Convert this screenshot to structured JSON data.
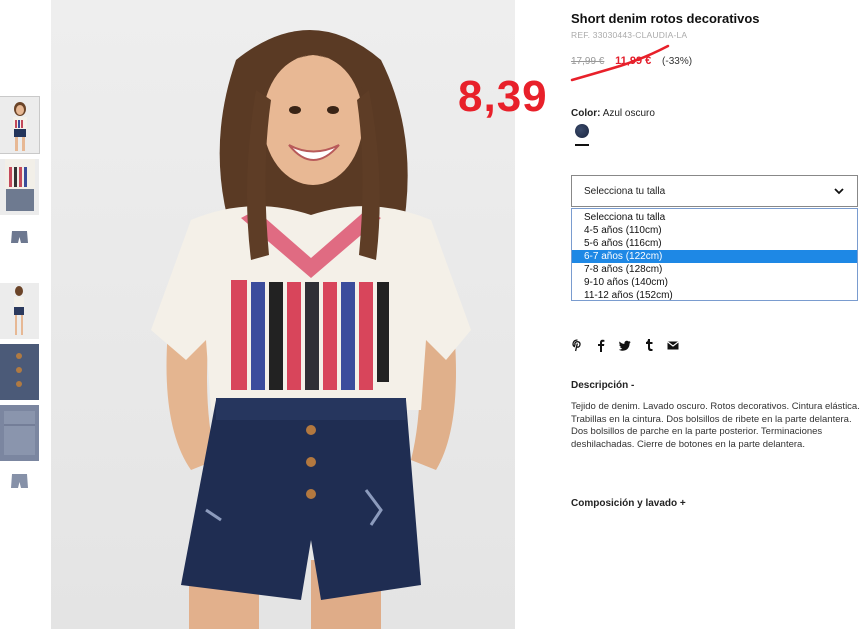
{
  "product": {
    "title": "Short denim rotos decorativos",
    "ref": "REF. 33030443-CLAUDIA-LA",
    "old_price": "17,99 €",
    "sale_price": "11,99 €",
    "discount": "(-33%)",
    "color_label": "Color:",
    "color_value": "Azul oscuro"
  },
  "annotation": {
    "handwritten_price": "8,39"
  },
  "size_select": {
    "current": "Selecciona tu talla",
    "options": [
      "Selecciona tu talla",
      "4-5 años (110cm)",
      "5-6 años (116cm)",
      "6-7 años (122cm)",
      "7-8 años (128cm)",
      "9-10 años (140cm)",
      "11-12 años (152cm)"
    ],
    "highlighted": "6-7 años (122cm)"
  },
  "share_icons": [
    "pinterest-icon",
    "facebook-icon",
    "twitter-icon",
    "tumblr-icon",
    "email-icon"
  ],
  "description": {
    "heading": "Descripción -",
    "body": "Tejido de denim. Lavado oscuro. Rotos decorativos. Cintura elástica. Trabillas en la cintura. Dos bolsillos de ribete en la parte delantera. Dos bolsillos de parche en la parte posterior. Terminaciones deshilachadas. Cierre de botones en la parte delantera."
  },
  "composition": {
    "heading": "Composición y lavado +"
  },
  "colors": {
    "sale_red": "#e31d2b",
    "annotation_red": "#e8202a",
    "highlight_blue": "#1e88e5"
  }
}
